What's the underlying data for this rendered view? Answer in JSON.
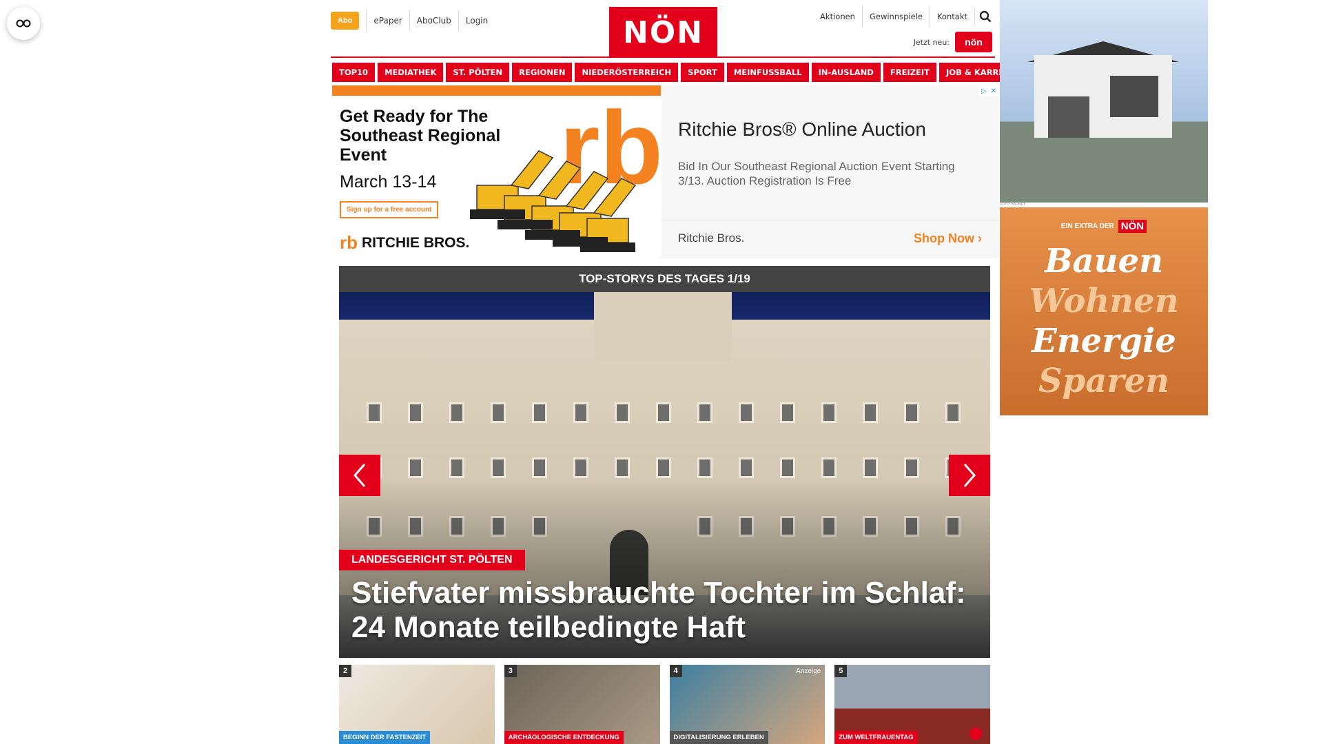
{
  "header": {
    "abo_label": "Abo",
    "top_links": [
      "ePaper",
      "AboClub",
      "Login"
    ],
    "logo_text": "NÖN",
    "right_links": [
      "Aktionen",
      "Gewinnspiele",
      "Kontakt"
    ],
    "jetzt_label": "Jetzt neu:",
    "jetzt_badge": "nön"
  },
  "nav": {
    "items": [
      "TOP10",
      "MEDIATHEK",
      "ST. PÖLTEN",
      "REGIONEN",
      "NIEDERÖSTERREICH",
      "SPORT",
      "MEINFUSSBALL",
      "IN-AUSLAND",
      "FREIZEIT",
      "JOB & KARRIERE"
    ]
  },
  "ad": {
    "headline": "Get Ready for The Southeast Regional Event",
    "date": "March 13-14",
    "signup": "Sign up for a free account",
    "brand": "RITCHIE BROS.",
    "title": "Ritchie Bros® Online Auction",
    "description": "Bid In Our Southeast Regional Auction Event Starting 3/13. Auction Registration Is Free",
    "advertiser": "Ritchie Bros.",
    "cta": "Shop Now"
  },
  "stories": {
    "bar_title": "TOP-STORYS DES TAGES 1/19",
    "kicker": "LANDESGERICHT ST. PÖLTEN",
    "headline": "Stiefvater missbrauchte Tochter im Schlaf: 24 Monate teilbedingte Haft"
  },
  "thumbs": [
    {
      "num": "2",
      "tag": "BEGINN DER FASTENZEIT"
    },
    {
      "num": "3",
      "tag": "ARCHÄOLOGISCHE ENTDECKUNG"
    },
    {
      "num": "4",
      "tag": "DIGITALISIERUNG ERLEBEN",
      "ad_label": "Anzeige"
    },
    {
      "num": "5",
      "tag": "ZUM WELTFRAUENTAG"
    }
  ],
  "sidebar": {
    "house_caption": "FOTO: BAUNET",
    "extra_label": "EIN EXTRA DER",
    "extra_logo": "NÖN",
    "bauen_lines": [
      "Bauen",
      "Wohnen",
      "Energie",
      "Sparen"
    ]
  },
  "colors": {
    "brand_red": "#e2001a",
    "abo_orange": "#f5a31a",
    "ad_orange": "#f58220",
    "stories_bar": "#444444"
  },
  "icons": {
    "reader": "reader-glasses-icon",
    "search": "search-icon",
    "prev": "chevron-left-icon",
    "next": "chevron-right-icon"
  }
}
